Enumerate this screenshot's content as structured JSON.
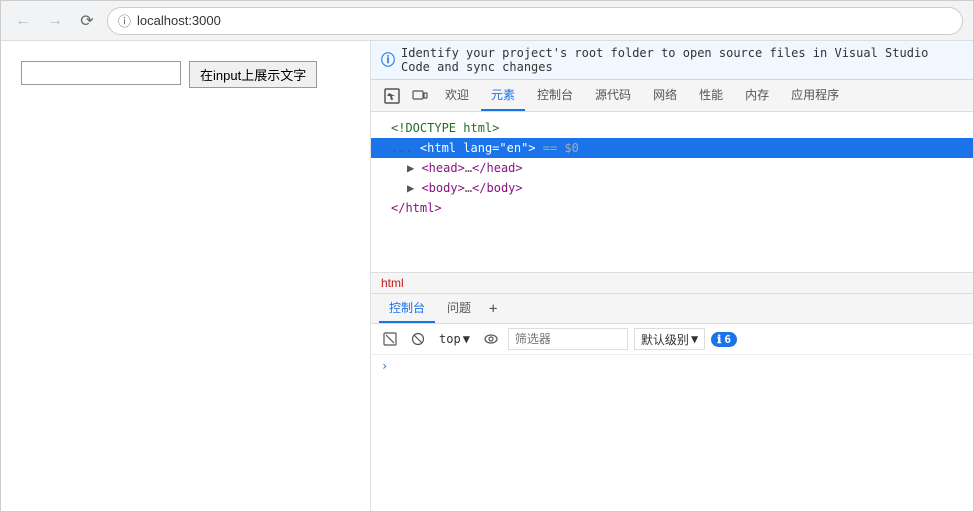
{
  "browser": {
    "url": "localhost:3000",
    "back_disabled": true,
    "forward_disabled": true
  },
  "page": {
    "input_placeholder": "",
    "button_label": "在input上展示文字"
  },
  "devtools": {
    "info_bar": "Identify your project's root folder to open source files in Visual Studio Code and sync changes",
    "tabs": [
      {
        "id": "inspect",
        "label": "⬛",
        "is_icon": true
      },
      {
        "id": "devices",
        "label": "⬜",
        "is_icon": true
      },
      {
        "id": "welcome",
        "label": "欢迎"
      },
      {
        "id": "elements",
        "label": "元素",
        "active": true
      },
      {
        "id": "console",
        "label": "控制台"
      },
      {
        "id": "sources",
        "label": "源代码"
      },
      {
        "id": "network",
        "label": "网络"
      },
      {
        "id": "performance",
        "label": "性能"
      },
      {
        "id": "memory",
        "label": "内存"
      },
      {
        "id": "application",
        "label": "应用程序"
      }
    ],
    "dom": {
      "lines": [
        {
          "id": "doctype",
          "indent": 1,
          "content": "<!DOCTYPE html>",
          "type": "doctype"
        },
        {
          "id": "html",
          "indent": 1,
          "content": "",
          "type": "html-selected"
        },
        {
          "id": "head",
          "indent": 2,
          "content": "",
          "type": "head"
        },
        {
          "id": "body",
          "indent": 2,
          "content": "",
          "type": "body"
        },
        {
          "id": "html-close",
          "indent": 1,
          "content": "</html>",
          "type": "close"
        }
      ]
    },
    "breadcrumb": "html",
    "console_tabs": [
      {
        "id": "console",
        "label": "控制台",
        "active": true
      },
      {
        "id": "issues",
        "label": "问题"
      }
    ],
    "console_toolbar": {
      "clear_icon": "⊘",
      "block_icon": "⊗",
      "top_label": "top",
      "eye_icon": "👁",
      "filter_placeholder": "筛选器",
      "level_label": "默认级别",
      "error_count": "6"
    },
    "console_content": {
      "chevron": "›"
    }
  }
}
